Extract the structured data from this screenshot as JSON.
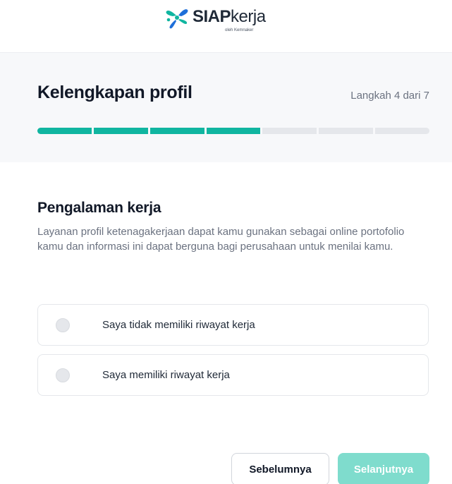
{
  "brand": {
    "name_bold": "SIAP",
    "name_light": "kerja",
    "tagline": "oleh Kemnaker",
    "colors": {
      "green": "#10b5a0",
      "blue": "#1e6fd9"
    }
  },
  "progress": {
    "title": "Kelengkapan profil",
    "step_text": "Langkah 4 dari 7",
    "current_step": 4,
    "total_steps": 7,
    "active_color": "#10b5a0"
  },
  "section": {
    "title": "Pengalaman kerja",
    "description": "Layanan profil ketenagakerjaan dapat kamu gunakan sebagai online portofolio kamu dan informasi ini dapat berguna bagi perusahaan untuk menilai kamu."
  },
  "options": [
    {
      "label": "Saya tidak memiliki riwayat kerja",
      "selected": false
    },
    {
      "label": "Saya memiliki riwayat kerja",
      "selected": false
    }
  ],
  "buttons": {
    "previous": "Sebelumnya",
    "next": "Selanjutnya"
  }
}
